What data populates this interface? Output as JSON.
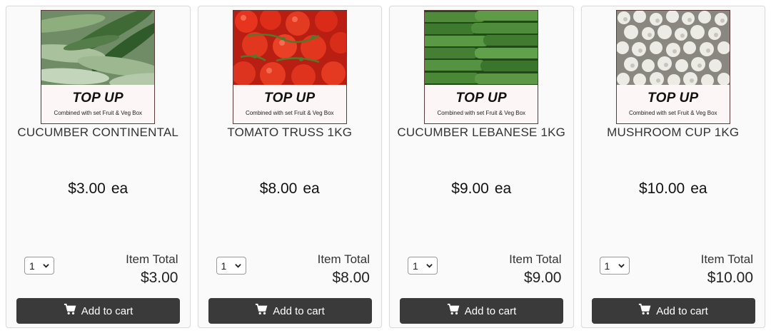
{
  "colors": {
    "button_bg": "#3a3a3b",
    "card_bg": "#fafafa",
    "card_border": "#dcdcdc",
    "topup_bg": "#fdf6f7"
  },
  "products": [
    {
      "image_icon": "cucumber-continental-photo",
      "badge_title": "TOP UP",
      "badge_subtitle": "Combined with set Fruit & Veg Box",
      "name": "CUCUMBER CONTINENTAL",
      "price": "$3.00",
      "unit": "ea",
      "quantity": "1",
      "item_total_label": "Item Total",
      "item_total": "$3.00",
      "add_to_cart_label": "Add to cart",
      "cart_icon": "shopping-cart-icon"
    },
    {
      "image_icon": "tomato-truss-photo",
      "badge_title": "TOP UP",
      "badge_subtitle": "Combined with set Fruit & Veg Box",
      "name": "TOMATO TRUSS 1KG",
      "price": "$8.00",
      "unit": "ea",
      "quantity": "1",
      "item_total_label": "Item Total",
      "item_total": "$8.00",
      "add_to_cart_label": "Add to cart",
      "cart_icon": "shopping-cart-icon"
    },
    {
      "image_icon": "cucumber-lebanese-photo",
      "badge_title": "TOP UP",
      "badge_subtitle": "Combined with set Fruit & Veg Box",
      "name": "CUCUMBER LEBANESE 1KG",
      "price": "$9.00",
      "unit": "ea",
      "quantity": "1",
      "item_total_label": "Item Total",
      "item_total": "$9.00",
      "add_to_cart_label": "Add to cart",
      "cart_icon": "shopping-cart-icon"
    },
    {
      "image_icon": "mushroom-cup-photo",
      "badge_title": "TOP UP",
      "badge_subtitle": "Combined with set Fruit & Veg Box",
      "name": "MUSHROOM CUP 1KG",
      "price": "$10.00",
      "unit": "ea",
      "quantity": "1",
      "item_total_label": "Item Total",
      "item_total": "$10.00",
      "add_to_cart_label": "Add to cart",
      "cart_icon": "shopping-cart-icon"
    }
  ]
}
